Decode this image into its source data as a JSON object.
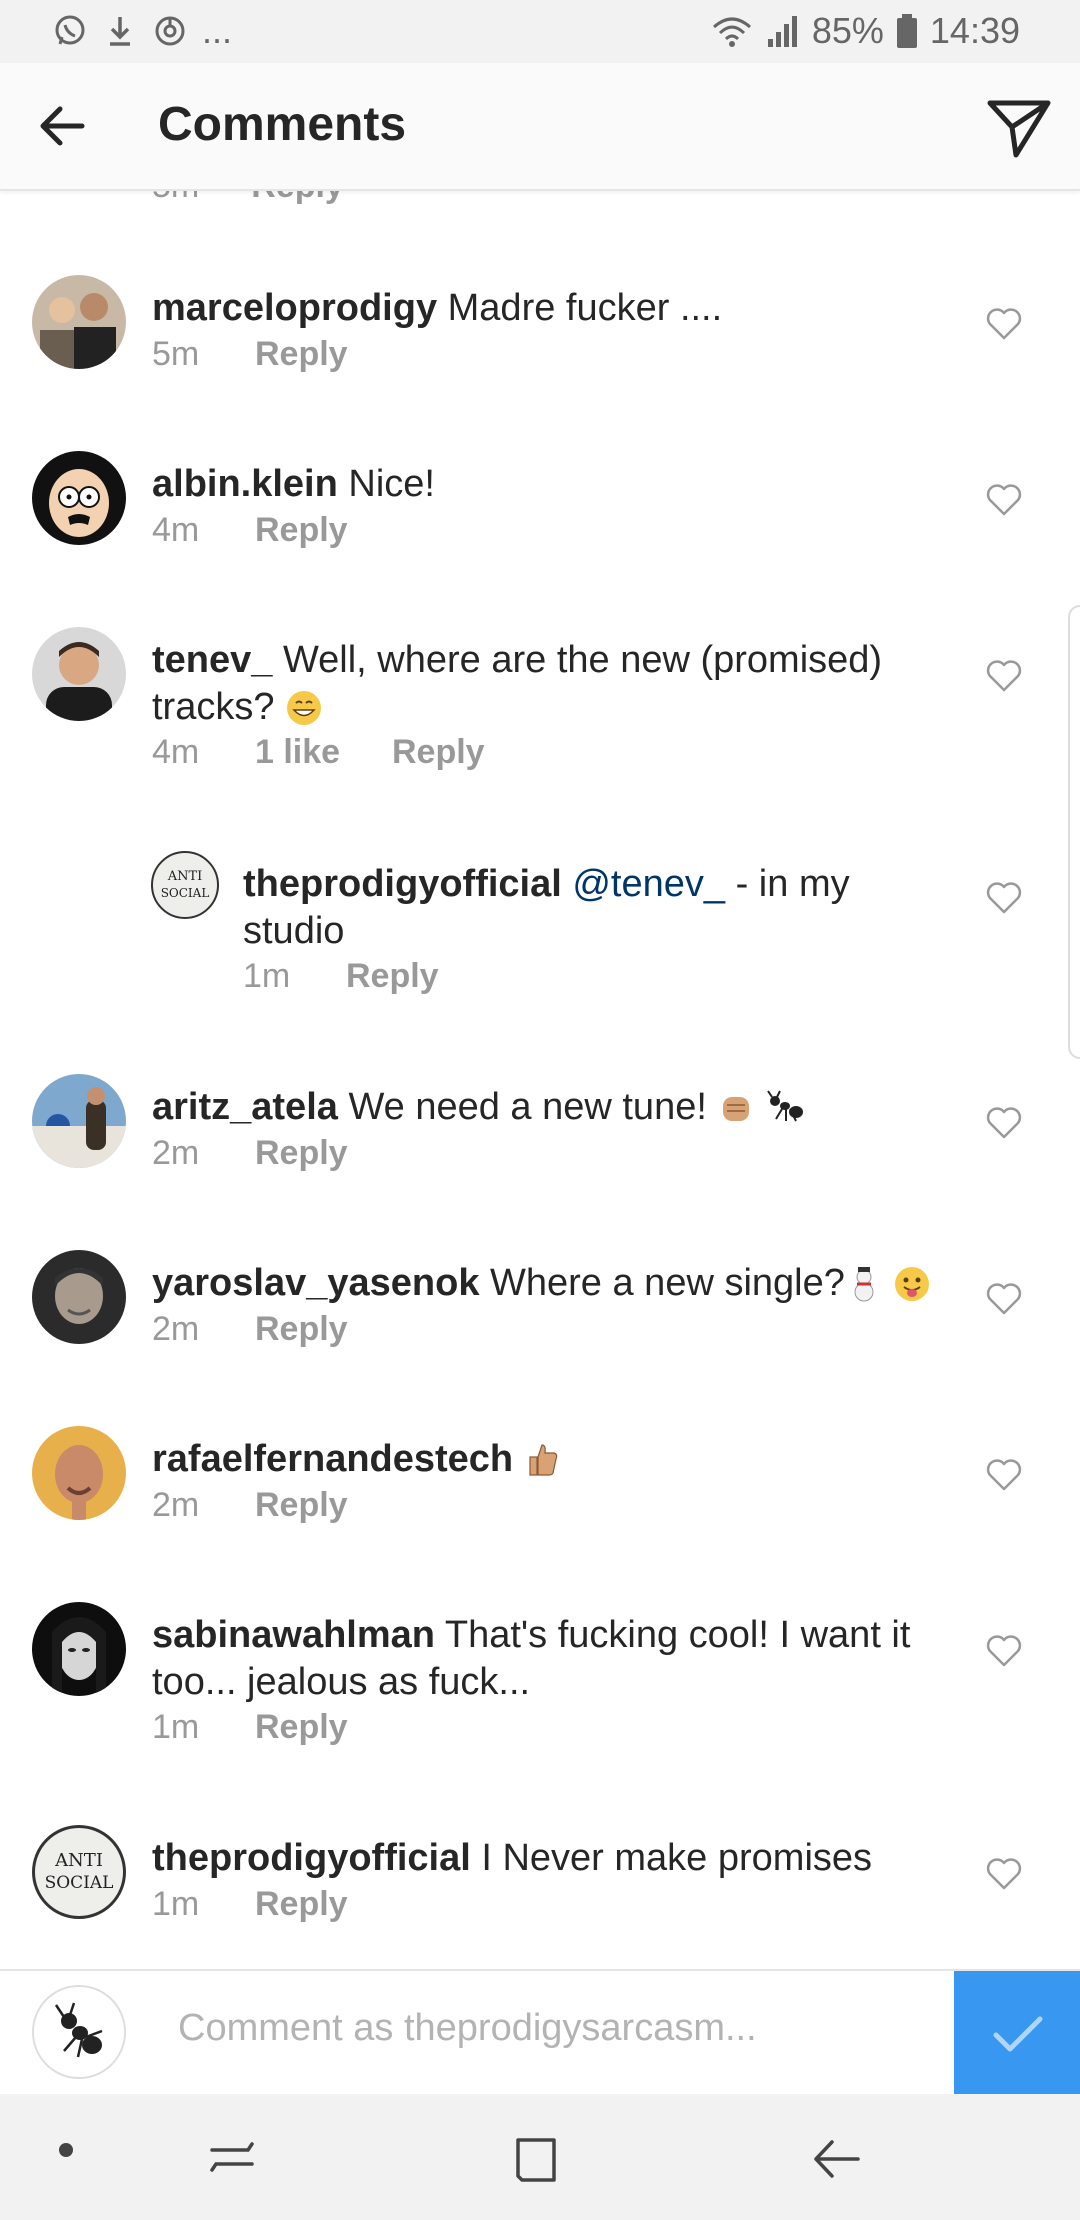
{
  "status_bar": {
    "battery": "85%",
    "time": "14:39",
    "more": "..."
  },
  "header": {
    "title": "Comments"
  },
  "partial_row": {
    "time": "5m",
    "reply": "Reply"
  },
  "comments": [
    {
      "username": "marceloprodigy",
      "text": "Madre fucker ....",
      "time": "5m",
      "likes": "",
      "reply": "Reply"
    },
    {
      "username": "albin.klein",
      "text": "Nice!",
      "time": "4m",
      "likes": "",
      "reply": "Reply"
    },
    {
      "username": "tenev_",
      "text": "Well, where are the new (promised) tracks?",
      "time": "4m",
      "likes": "1 like",
      "reply": "Reply"
    },
    {
      "username": "theprodigyofficial",
      "mention": "@tenev_",
      "text": "- in my studio",
      "time": "1m",
      "likes": "",
      "reply": "Reply"
    },
    {
      "username": "aritz_atela",
      "text": "We need a new tune!",
      "time": "2m",
      "likes": "",
      "reply": "Reply"
    },
    {
      "username": "yaroslav_yasenok",
      "text": "Where a new single?",
      "time": "2m",
      "likes": "",
      "reply": "Reply"
    },
    {
      "username": "rafaelfernandestech",
      "text": "",
      "time": "2m",
      "likes": "",
      "reply": "Reply"
    },
    {
      "username": "sabinawahlman",
      "text": "That's fucking cool! I want it too... jealous as fuck...",
      "time": "1m",
      "likes": "",
      "reply": "Reply"
    },
    {
      "username": "theprodigyofficial",
      "text": "I Never make promises",
      "time": "1m",
      "likes": "",
      "reply": "Reply"
    }
  ],
  "composer": {
    "placeholder": "Comment as theprodigysarcasm..."
  },
  "avatar_logo": {
    "line1": "ANTI",
    "line2": "SOCIAL"
  },
  "colors": {
    "accent": "#3897f0",
    "mention": "#003569",
    "meta": "#999999"
  }
}
